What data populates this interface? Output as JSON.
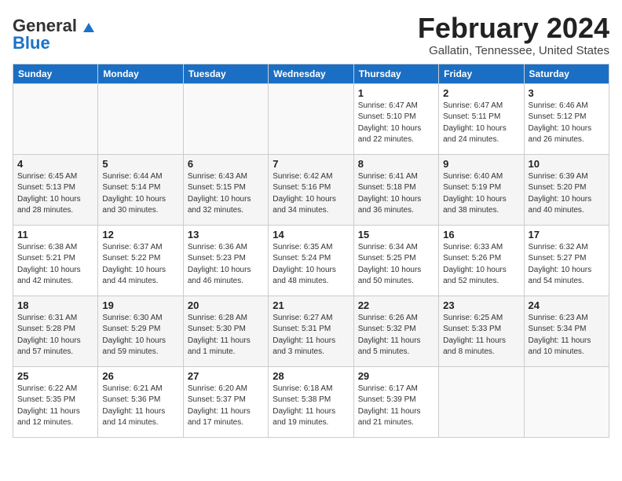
{
  "logo": {
    "general": "General",
    "blue": "Blue"
  },
  "title": "February 2024",
  "location": "Gallatin, Tennessee, United States",
  "days_of_week": [
    "Sunday",
    "Monday",
    "Tuesday",
    "Wednesday",
    "Thursday",
    "Friday",
    "Saturday"
  ],
  "weeks": [
    [
      {
        "day": "",
        "detail": ""
      },
      {
        "day": "",
        "detail": ""
      },
      {
        "day": "",
        "detail": ""
      },
      {
        "day": "",
        "detail": ""
      },
      {
        "day": "1",
        "detail": "Sunrise: 6:47 AM\nSunset: 5:10 PM\nDaylight: 10 hours\nand 22 minutes."
      },
      {
        "day": "2",
        "detail": "Sunrise: 6:47 AM\nSunset: 5:11 PM\nDaylight: 10 hours\nand 24 minutes."
      },
      {
        "day": "3",
        "detail": "Sunrise: 6:46 AM\nSunset: 5:12 PM\nDaylight: 10 hours\nand 26 minutes."
      }
    ],
    [
      {
        "day": "4",
        "detail": "Sunrise: 6:45 AM\nSunset: 5:13 PM\nDaylight: 10 hours\nand 28 minutes."
      },
      {
        "day": "5",
        "detail": "Sunrise: 6:44 AM\nSunset: 5:14 PM\nDaylight: 10 hours\nand 30 minutes."
      },
      {
        "day": "6",
        "detail": "Sunrise: 6:43 AM\nSunset: 5:15 PM\nDaylight: 10 hours\nand 32 minutes."
      },
      {
        "day": "7",
        "detail": "Sunrise: 6:42 AM\nSunset: 5:16 PM\nDaylight: 10 hours\nand 34 minutes."
      },
      {
        "day": "8",
        "detail": "Sunrise: 6:41 AM\nSunset: 5:18 PM\nDaylight: 10 hours\nand 36 minutes."
      },
      {
        "day": "9",
        "detail": "Sunrise: 6:40 AM\nSunset: 5:19 PM\nDaylight: 10 hours\nand 38 minutes."
      },
      {
        "day": "10",
        "detail": "Sunrise: 6:39 AM\nSunset: 5:20 PM\nDaylight: 10 hours\nand 40 minutes."
      }
    ],
    [
      {
        "day": "11",
        "detail": "Sunrise: 6:38 AM\nSunset: 5:21 PM\nDaylight: 10 hours\nand 42 minutes."
      },
      {
        "day": "12",
        "detail": "Sunrise: 6:37 AM\nSunset: 5:22 PM\nDaylight: 10 hours\nand 44 minutes."
      },
      {
        "day": "13",
        "detail": "Sunrise: 6:36 AM\nSunset: 5:23 PM\nDaylight: 10 hours\nand 46 minutes."
      },
      {
        "day": "14",
        "detail": "Sunrise: 6:35 AM\nSunset: 5:24 PM\nDaylight: 10 hours\nand 48 minutes."
      },
      {
        "day": "15",
        "detail": "Sunrise: 6:34 AM\nSunset: 5:25 PM\nDaylight: 10 hours\nand 50 minutes."
      },
      {
        "day": "16",
        "detail": "Sunrise: 6:33 AM\nSunset: 5:26 PM\nDaylight: 10 hours\nand 52 minutes."
      },
      {
        "day": "17",
        "detail": "Sunrise: 6:32 AM\nSunset: 5:27 PM\nDaylight: 10 hours\nand 54 minutes."
      }
    ],
    [
      {
        "day": "18",
        "detail": "Sunrise: 6:31 AM\nSunset: 5:28 PM\nDaylight: 10 hours\nand 57 minutes."
      },
      {
        "day": "19",
        "detail": "Sunrise: 6:30 AM\nSunset: 5:29 PM\nDaylight: 10 hours\nand 59 minutes."
      },
      {
        "day": "20",
        "detail": "Sunrise: 6:28 AM\nSunset: 5:30 PM\nDaylight: 11 hours\nand 1 minute."
      },
      {
        "day": "21",
        "detail": "Sunrise: 6:27 AM\nSunset: 5:31 PM\nDaylight: 11 hours\nand 3 minutes."
      },
      {
        "day": "22",
        "detail": "Sunrise: 6:26 AM\nSunset: 5:32 PM\nDaylight: 11 hours\nand 5 minutes."
      },
      {
        "day": "23",
        "detail": "Sunrise: 6:25 AM\nSunset: 5:33 PM\nDaylight: 11 hours\nand 8 minutes."
      },
      {
        "day": "24",
        "detail": "Sunrise: 6:23 AM\nSunset: 5:34 PM\nDaylight: 11 hours\nand 10 minutes."
      }
    ],
    [
      {
        "day": "25",
        "detail": "Sunrise: 6:22 AM\nSunset: 5:35 PM\nDaylight: 11 hours\nand 12 minutes."
      },
      {
        "day": "26",
        "detail": "Sunrise: 6:21 AM\nSunset: 5:36 PM\nDaylight: 11 hours\nand 14 minutes."
      },
      {
        "day": "27",
        "detail": "Sunrise: 6:20 AM\nSunset: 5:37 PM\nDaylight: 11 hours\nand 17 minutes."
      },
      {
        "day": "28",
        "detail": "Sunrise: 6:18 AM\nSunset: 5:38 PM\nDaylight: 11 hours\nand 19 minutes."
      },
      {
        "day": "29",
        "detail": "Sunrise: 6:17 AM\nSunset: 5:39 PM\nDaylight: 11 hours\nand 21 minutes."
      },
      {
        "day": "",
        "detail": ""
      },
      {
        "day": "",
        "detail": ""
      }
    ]
  ]
}
